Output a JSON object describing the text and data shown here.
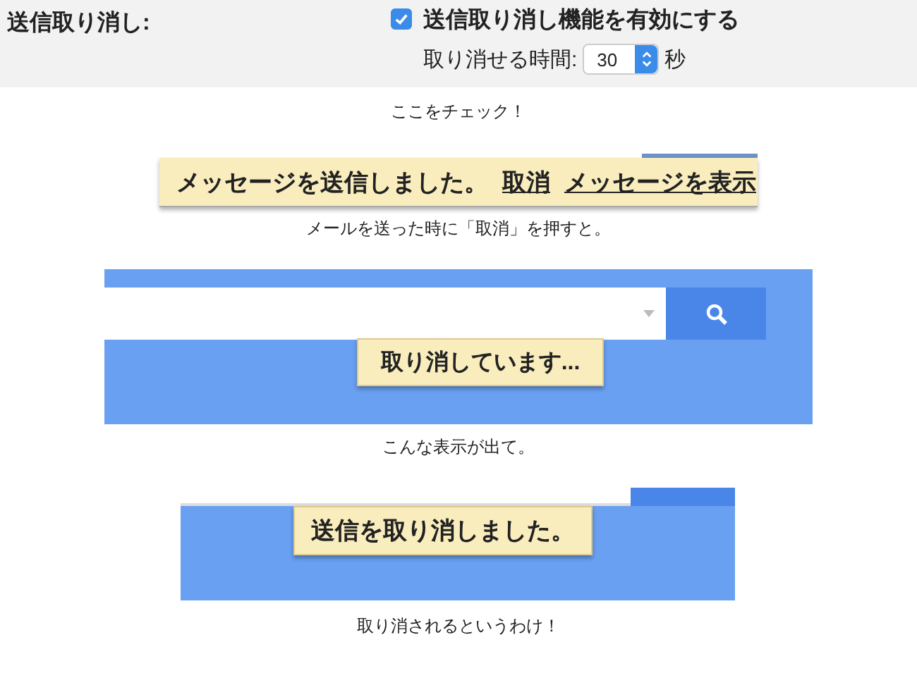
{
  "settings": {
    "label": "送信取り消し:",
    "checkbox": {
      "label": "送信取り消し機能を有効にする",
      "checked": true
    },
    "time": {
      "label": "取り消せる時間:",
      "value": "30",
      "unit": "秒"
    }
  },
  "caption_1": "ここをチェック！",
  "sent_toast": {
    "message": "メッセージを送信しました。",
    "links": [
      "取消",
      "メッセージを表示"
    ]
  },
  "caption_2": "メールを送った時に「取消」を押すと。",
  "undoing_toast": {
    "message": "取り消しています..."
  },
  "caption_3": "こんな表示が出て。",
  "undone_toast": {
    "message": "送信を取り消しました。"
  },
  "caption_4": "取り消されるというわけ！"
}
